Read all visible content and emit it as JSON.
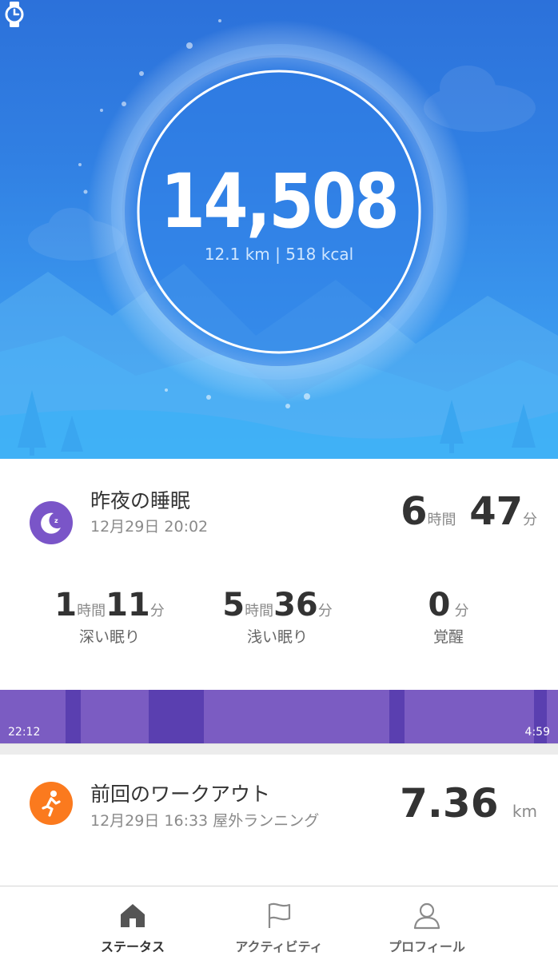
{
  "summary": {
    "steps": "14,508",
    "distance_calories": "12.1 km | 518 kcal",
    "device_icon": "watch-icon",
    "colors": {
      "sky_top": "#2c71da",
      "sky_bottom": "#45aef5",
      "ring": "#ffffff"
    }
  },
  "sleep": {
    "icon": "moon-icon",
    "title": "昨夜の睡眠",
    "timestamp": "12月29日 20:02",
    "total": {
      "hours": "6",
      "hours_unit": "時間",
      "minutes": "47",
      "minutes_unit": "分"
    },
    "stats": [
      {
        "hours": "1",
        "hours_unit": "時間",
        "minutes": "11",
        "minutes_unit": "分",
        "label": "深い眠り"
      },
      {
        "hours": "5",
        "hours_unit": "時間",
        "minutes": "36",
        "minutes_unit": "分",
        "label": "浅い眠り"
      },
      {
        "minutes": "0",
        "minutes_unit": "分",
        "label": "覚醒"
      }
    ],
    "start_time": "22:12",
    "end_time": "4:59",
    "colors": {
      "light": "#7b5cc2",
      "deep": "#5a3fb0",
      "icon_bg": "#7a55c8"
    }
  },
  "workout": {
    "icon": "running-icon",
    "title": "前回のワークアウト",
    "timestamp": "12月29日 16:33 屋外ランニング",
    "distance": "7.36",
    "distance_unit": "km",
    "colors": {
      "icon_bg": "#fb7a1e"
    }
  },
  "nav": {
    "tabs": [
      {
        "label": "ステータス",
        "icon": "home-icon",
        "active": true
      },
      {
        "label": "アクティビティ",
        "icon": "flag-icon",
        "active": false
      },
      {
        "label": "プロフィール",
        "icon": "person-icon",
        "active": false
      }
    ]
  }
}
